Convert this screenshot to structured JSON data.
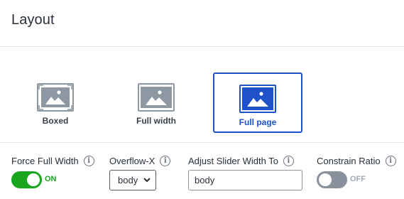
{
  "title": "Layout",
  "layout_options": [
    {
      "label": "Boxed",
      "icon": "boxed-layout-icon",
      "selected": false
    },
    {
      "label": "Full width",
      "icon": "full-width-layout-icon",
      "selected": false
    },
    {
      "label": "Full page",
      "icon": "full-page-layout-icon",
      "selected": true
    }
  ],
  "fields": {
    "force_full_width": {
      "label": "Force Full Width",
      "state": "ON"
    },
    "overflow_x": {
      "label": "Overflow-X",
      "value": "body"
    },
    "adjust_slider_width_to": {
      "label": "Adjust Slider Width To",
      "value": "body"
    },
    "constrain_ratio": {
      "label": "Constrain Ratio",
      "state": "OFF"
    }
  },
  "info_glyph": "i",
  "colors": {
    "accent": "#1f52c8",
    "toggle_on": "#1aa51f",
    "toggle_off": "#89929c",
    "thumb_inactive": "#8d98a3"
  }
}
